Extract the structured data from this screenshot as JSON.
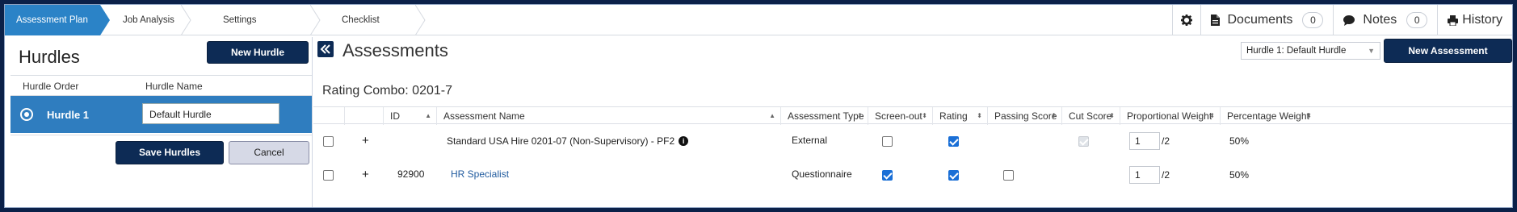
{
  "nav": {
    "steps": [
      "Assessment Plan",
      "Job Analysis",
      "Settings",
      "Checklist"
    ],
    "active_step": "Assessment Plan",
    "documents_label": "Documents",
    "documents_count": "0",
    "notes_label": "Notes",
    "notes_count": "0",
    "history_label": "History"
  },
  "hurdles": {
    "title": "Hurdles",
    "new_button": "New Hurdle",
    "col_order": "Hurdle Order",
    "col_name": "Hurdle Name",
    "rows": [
      {
        "label": "Hurdle 1",
        "name": "Default Hurdle"
      }
    ],
    "save_button": "Save Hurdles",
    "cancel_button": "Cancel"
  },
  "assessments": {
    "title": "Assessments",
    "hurdle_select": "Hurdle 1: Default Hurdle",
    "new_button": "New Assessment",
    "rating_combo": "Rating Combo: 0201-7",
    "columns": [
      "ID",
      "Assessment Name",
      "Assessment Type",
      "Screen-out",
      "Rating",
      "Passing Score",
      "Cut Score",
      "Proportional Weight",
      "Percentage Weight"
    ],
    "rows": [
      {
        "expand": "+",
        "id": "",
        "name": "Standard USA Hire 0201-07 (Non-Supervisory) - PF2",
        "type": "External",
        "screen_out": false,
        "rating": true,
        "passing_score": null,
        "cut_score": "disabled-checked",
        "weight": "1",
        "weight_of": "/2",
        "percentage": "50%"
      },
      {
        "expand": "+",
        "id": "92900",
        "name": "HR Specialist",
        "type": "Questionnaire",
        "screen_out": true,
        "rating": true,
        "passing_score": false,
        "cut_score": null,
        "weight": "1",
        "weight_of": "/2",
        "percentage": "50%"
      }
    ]
  },
  "colors": {
    "brand_dark": "#0d2b55",
    "accent_blue": "#2b83c7",
    "selected_row": "#2f7dbf"
  }
}
